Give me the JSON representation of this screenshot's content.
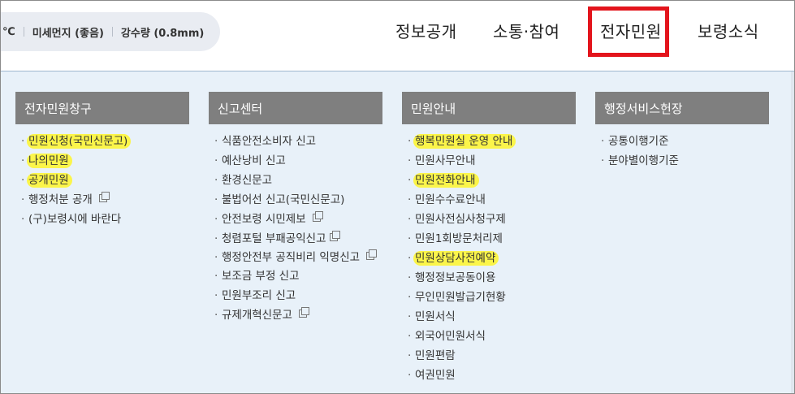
{
  "weather": {
    "temp_unit": "℃",
    "dust": "미세먼지 (좋음)",
    "rain": "강수량 (0.8mm)"
  },
  "nav": {
    "items": [
      "정보공개",
      "소통·참여",
      "전자민원",
      "보령소식"
    ]
  },
  "menu": {
    "columns": [
      {
        "title": "전자민원창구",
        "items": [
          {
            "label": "민원신청(국민신문고)"
          },
          {
            "label": "나의민원"
          },
          {
            "label": "공개민원"
          },
          {
            "label": "행정처분 공개"
          },
          {
            "label": "(구)보령시에 바란다"
          }
        ]
      },
      {
        "title": "신고센터",
        "items": [
          {
            "label": "식품안전소비자 신고"
          },
          {
            "label": "예산낭비 신고"
          },
          {
            "label": "환경신문고"
          },
          {
            "label": "불법어선 신고(국민신문고)"
          },
          {
            "label": "안전보령 시민제보"
          },
          {
            "label": "청렴포털 부패공익신고"
          },
          {
            "label": "행정안전부 공직비리 익명신고"
          },
          {
            "label": "보조금 부정 신고"
          },
          {
            "label": "민원부조리 신고"
          },
          {
            "label": "규제개혁신문고"
          }
        ]
      },
      {
        "title": "민원안내",
        "items": [
          {
            "label": "행복민원실 운영 안내"
          },
          {
            "label": "민원사무안내"
          },
          {
            "label": "민원전화안내"
          },
          {
            "label": "민원수수료안내"
          },
          {
            "label": "민원사전심사청구제"
          },
          {
            "label": "민원1회방문처리제"
          },
          {
            "label": "민원상담사전예약"
          },
          {
            "label": "행정정보공동이용"
          },
          {
            "label": "무인민원발급기현황"
          },
          {
            "label": "민원서식"
          },
          {
            "label": "외국어민원서식"
          },
          {
            "label": "민원편람"
          },
          {
            "label": "여권민원"
          }
        ]
      },
      {
        "title": "행정서비스헌장",
        "items": [
          {
            "label": "공통이행기준"
          },
          {
            "label": "분야별이행기준"
          }
        ]
      }
    ]
  }
}
